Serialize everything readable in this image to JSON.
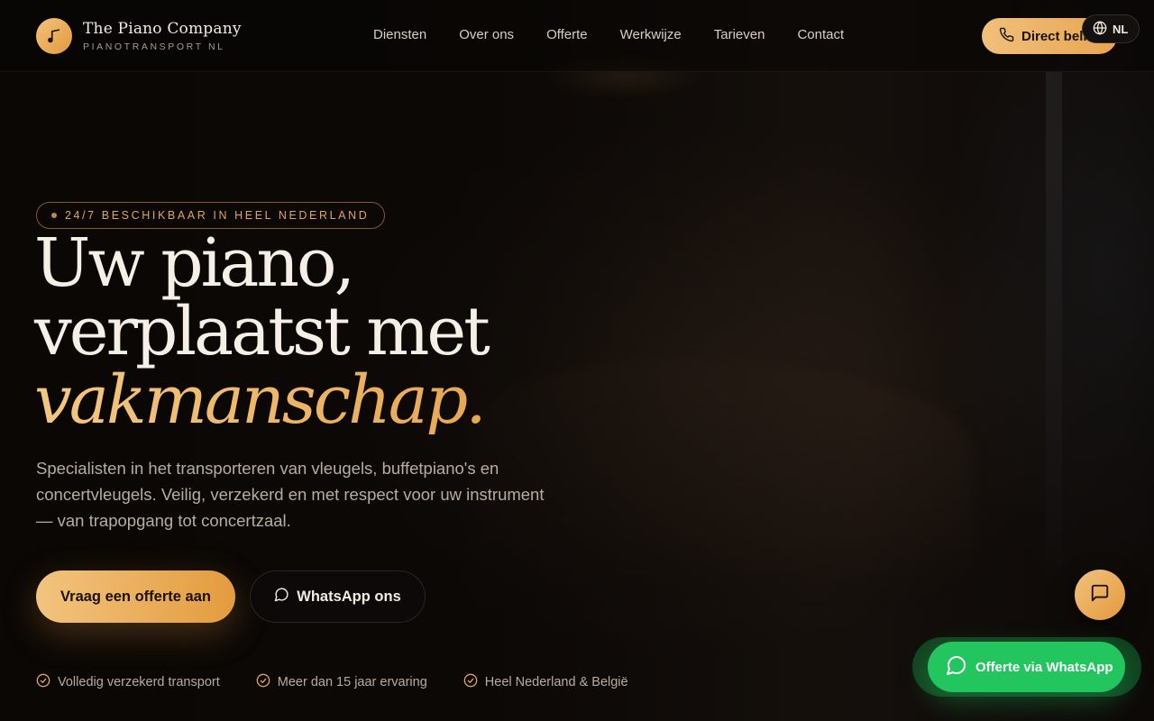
{
  "brand": {
    "name": "The Piano Company",
    "subtitle": "PIANOTRANSPORT NL",
    "logo_icon": "music-note-icon",
    "accent_color": "#e8a552",
    "accent_light": "#f2c47e"
  },
  "nav": {
    "items": [
      {
        "label": "Diensten"
      },
      {
        "label": "Over ons"
      },
      {
        "label": "Offerte"
      },
      {
        "label": "Werkwijze"
      },
      {
        "label": "Tarieven"
      },
      {
        "label": "Contact"
      }
    ]
  },
  "header_actions": {
    "call_label": "Direct bellen",
    "call_icon": "phone-icon",
    "language_label": "NL",
    "language_icon": "globe-icon"
  },
  "hero": {
    "badge": "24/7 BESCHIKBAAR IN HEEL NEDERLAND",
    "title_line1": "Uw piano,",
    "title_line2": "verplaatst met",
    "title_accent": "vakmanschap.",
    "lead": "Specialisten in het transporteren van vleugels, buffetpiano's en concertvleugels. Veilig, verzekerd en met respect voor uw instrument — van trapopgang tot concertzaal.",
    "cta_primary": "Vraag een offerte aan",
    "cta_secondary": "WhatsApp ons",
    "features": [
      {
        "label": "Volledig verzekerd transport",
        "icon": "check-circle-icon"
      },
      {
        "label": "Meer dan 15 jaar ervaring",
        "icon": "check-circle-icon"
      },
      {
        "label": "Heel Nederland & België",
        "icon": "check-circle-icon"
      }
    ]
  },
  "floating": {
    "chat_icon": "chat-bubble-icon",
    "whatsapp_label": "Offerte via WhatsApp",
    "whatsapp_color": "#22c55e"
  }
}
